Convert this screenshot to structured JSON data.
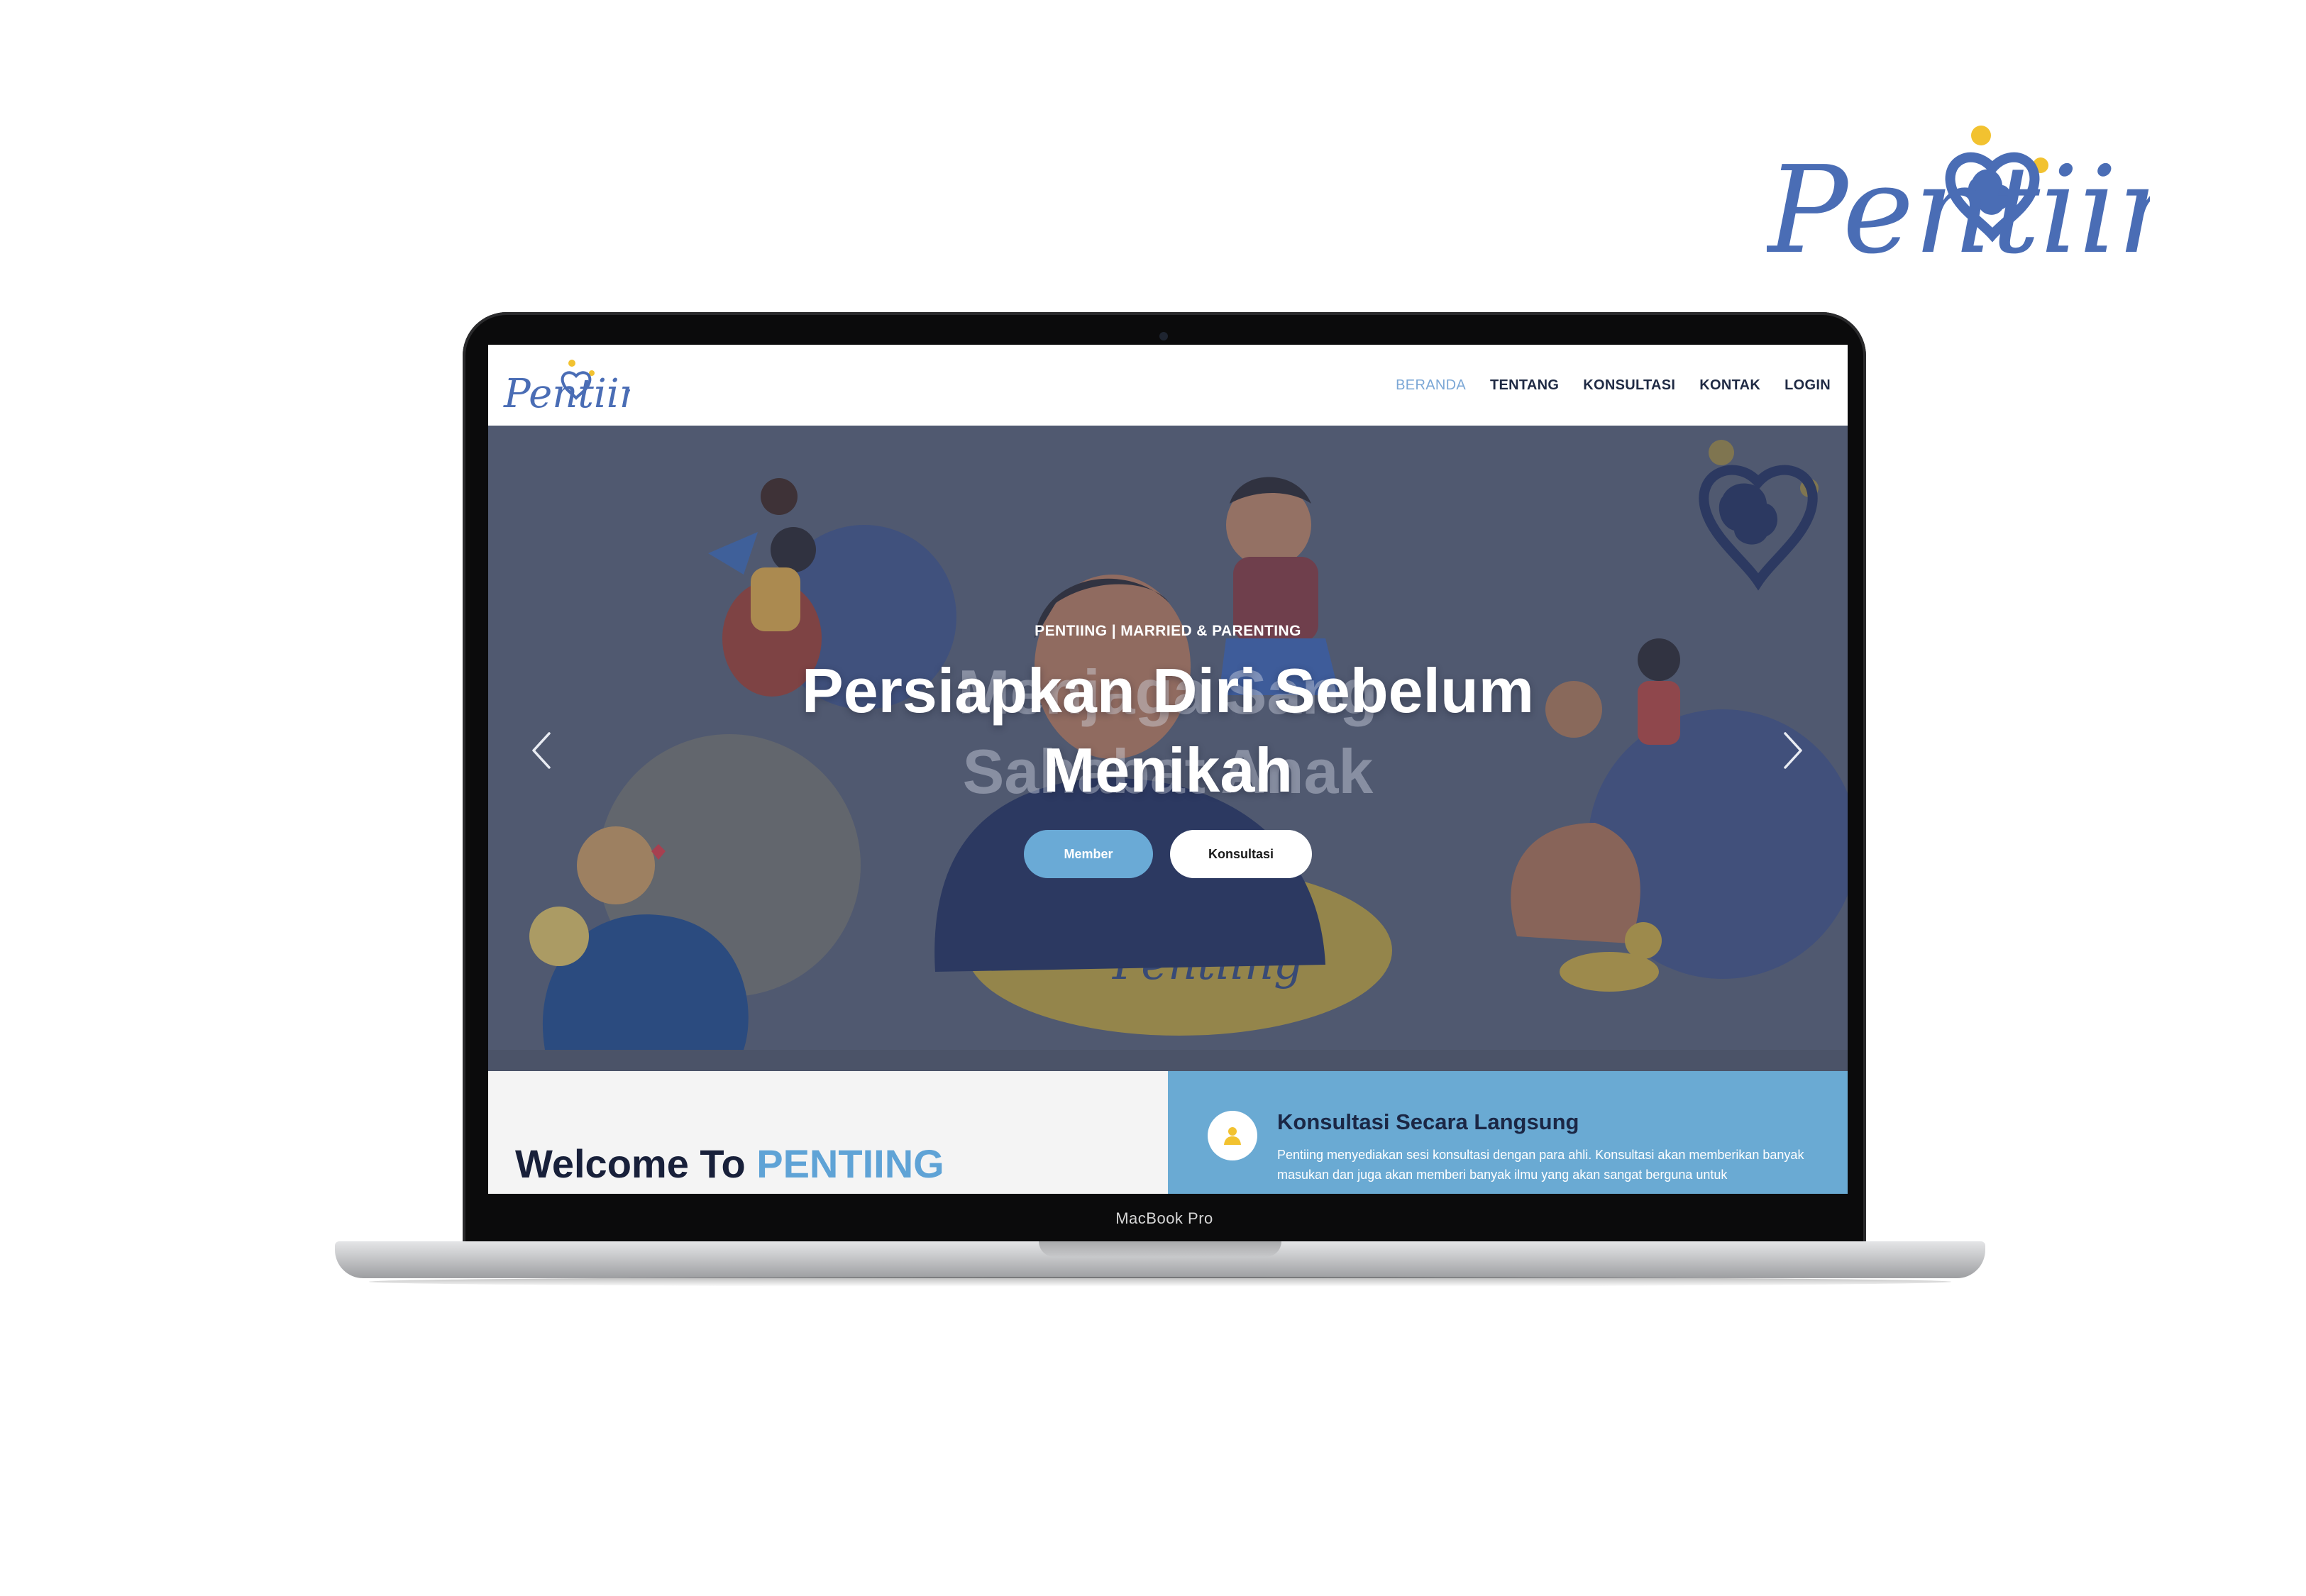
{
  "brand": {
    "logo_text": "Pentiing"
  },
  "device": {
    "label": "MacBook Pro"
  },
  "header": {
    "logo_text": "Pentiing",
    "nav": [
      {
        "label": "BERANDA",
        "active": true
      },
      {
        "label": "TENTANG",
        "active": false
      },
      {
        "label": "KONSULTASI",
        "active": false
      },
      {
        "label": "KONTAK",
        "active": false
      },
      {
        "label": "LOGIN",
        "active": false
      }
    ]
  },
  "hero": {
    "eyebrow": "PENTIING | MARRIED & PARENTING",
    "title_line1": "Persiapkan Diri Sebelum",
    "title_line2": "Menikah",
    "ghost_line1": "Menjaga Sang",
    "ghost_line2": "Sahabat Anak",
    "illustration_logo_text": "Pentiing",
    "buttons": {
      "member": "Member",
      "konsultasi": "Konsultasi"
    },
    "prev_icon": "chevron-left-icon",
    "next_icon": "chevron-right-icon"
  },
  "welcome": {
    "title_prefix": "Welcome To",
    "title_accent": "PENTIING"
  },
  "konsultasi_card": {
    "icon": "user-icon",
    "title": "Konsultasi Secara Langsung",
    "text": "Pentiing menyediakan sesi konsultasi dengan para ahli. Konsultasi akan memberikan banyak masukan dan juga akan memberi banyak ilmu yang akan sangat berguna untuk"
  },
  "colors": {
    "logo_blue": "#4a6db5",
    "logo_yellow": "#f2c230",
    "accent_blue": "#6aaad6",
    "nav_active": "#7ba7d6",
    "hero_bg": "#535c73",
    "dark_text": "#18203a"
  }
}
